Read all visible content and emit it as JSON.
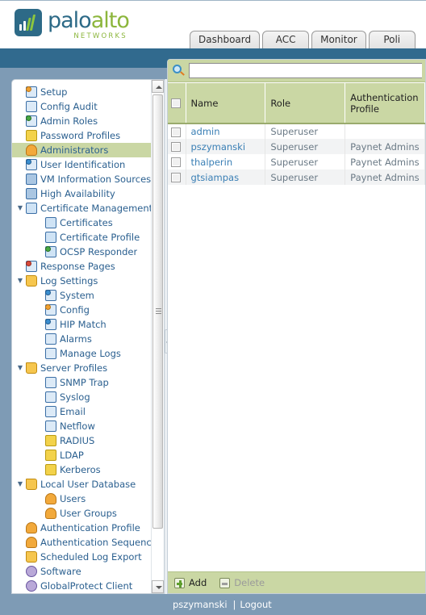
{
  "brand": {
    "name_part1": "palo",
    "name_part2": "alto",
    "tagline": "NETWORKS",
    "logo_icon": "paloalto-bars-logo"
  },
  "tabs": [
    {
      "label": "Dashboard"
    },
    {
      "label": "ACC"
    },
    {
      "label": "Monitor"
    },
    {
      "label": "Poli"
    }
  ],
  "sidebar": {
    "items": [
      {
        "label": "Setup",
        "level": 1,
        "twisty": "",
        "icon": "setup-icon",
        "selected": false
      },
      {
        "label": "Config Audit",
        "level": 1,
        "twisty": "",
        "icon": "config-audit-icon",
        "selected": false
      },
      {
        "label": "Admin Roles",
        "level": 1,
        "twisty": "",
        "icon": "admin-roles-icon",
        "selected": false
      },
      {
        "label": "Password Profiles",
        "level": 1,
        "twisty": "",
        "icon": "password-profiles-icon",
        "selected": false
      },
      {
        "label": "Administrators",
        "level": 1,
        "twisty": "",
        "icon": "administrators-icon",
        "selected": true
      },
      {
        "label": "User Identification",
        "level": 1,
        "twisty": "",
        "icon": "user-identification-icon",
        "selected": false
      },
      {
        "label": "VM Information Sources",
        "level": 1,
        "twisty": "",
        "icon": "vm-information-sources-icon",
        "selected": false
      },
      {
        "label": "High Availability",
        "level": 1,
        "twisty": "",
        "icon": "high-availability-icon",
        "selected": false
      },
      {
        "label": "Certificate Management",
        "level": 1,
        "twisty": "▼",
        "icon": "certificate-management-icon",
        "selected": false
      },
      {
        "label": "Certificates",
        "level": 2,
        "twisty": "",
        "icon": "certificates-icon",
        "selected": false
      },
      {
        "label": "Certificate Profile",
        "level": 2,
        "twisty": "",
        "icon": "certificate-profile-icon",
        "selected": false
      },
      {
        "label": "OCSP Responder",
        "level": 2,
        "twisty": "",
        "icon": "ocsp-responder-icon",
        "selected": false
      },
      {
        "label": "Response Pages",
        "level": 1,
        "twisty": "",
        "icon": "response-pages-icon",
        "selected": false
      },
      {
        "label": "Log Settings",
        "level": 1,
        "twisty": "▼",
        "icon": "log-settings-icon",
        "selected": false
      },
      {
        "label": "System",
        "level": 2,
        "twisty": "",
        "icon": "system-icon",
        "selected": false
      },
      {
        "label": "Config",
        "level": 2,
        "twisty": "",
        "icon": "config-icon",
        "selected": false
      },
      {
        "label": "HIP Match",
        "level": 2,
        "twisty": "",
        "icon": "hip-match-icon",
        "selected": false
      },
      {
        "label": "Alarms",
        "level": 2,
        "twisty": "",
        "icon": "alarms-icon",
        "selected": false
      },
      {
        "label": "Manage Logs",
        "level": 2,
        "twisty": "",
        "icon": "manage-logs-icon",
        "selected": false
      },
      {
        "label": "Server Profiles",
        "level": 1,
        "twisty": "▼",
        "icon": "server-profiles-icon",
        "selected": false
      },
      {
        "label": "SNMP Trap",
        "level": 2,
        "twisty": "",
        "icon": "snmp-trap-icon",
        "selected": false
      },
      {
        "label": "Syslog",
        "level": 2,
        "twisty": "",
        "icon": "syslog-icon",
        "selected": false
      },
      {
        "label": "Email",
        "level": 2,
        "twisty": "",
        "icon": "email-icon",
        "selected": false
      },
      {
        "label": "Netflow",
        "level": 2,
        "twisty": "",
        "icon": "netflow-icon",
        "selected": false
      },
      {
        "label": "RADIUS",
        "level": 2,
        "twisty": "",
        "icon": "radius-icon",
        "selected": false
      },
      {
        "label": "LDAP",
        "level": 2,
        "twisty": "",
        "icon": "ldap-icon",
        "selected": false
      },
      {
        "label": "Kerberos",
        "level": 2,
        "twisty": "",
        "icon": "kerberos-icon",
        "selected": false
      },
      {
        "label": "Local User Database",
        "level": 1,
        "twisty": "▼",
        "icon": "local-user-database-icon",
        "selected": false
      },
      {
        "label": "Users",
        "level": 2,
        "twisty": "",
        "icon": "users-icon",
        "selected": false
      },
      {
        "label": "User Groups",
        "level": 2,
        "twisty": "",
        "icon": "user-groups-icon",
        "selected": false
      },
      {
        "label": "Authentication Profile",
        "level": 1,
        "twisty": "",
        "icon": "authentication-profile-icon",
        "selected": false
      },
      {
        "label": "Authentication Sequence",
        "level": 1,
        "twisty": "",
        "icon": "authentication-sequence-icon",
        "selected": false
      },
      {
        "label": "Scheduled Log Export",
        "level": 1,
        "twisty": "",
        "icon": "scheduled-log-export-icon",
        "selected": false
      },
      {
        "label": "Software",
        "level": 1,
        "twisty": "",
        "icon": "software-icon",
        "selected": false
      },
      {
        "label": "GlobalProtect Client",
        "level": 1,
        "twisty": "",
        "icon": "globalprotect-client-icon",
        "selected": false
      }
    ]
  },
  "search": {
    "value": "",
    "placeholder": "",
    "icon": "search-icon"
  },
  "table": {
    "columns": [
      "Name",
      "Role",
      "Authentication Profile"
    ],
    "rows": [
      {
        "name": "admin",
        "role": "Superuser",
        "auth_profile": ""
      },
      {
        "name": "pszymanski",
        "role": "Superuser",
        "auth_profile": "Paynet Admins"
      },
      {
        "name": "thalperin",
        "role": "Superuser",
        "auth_profile": "Paynet Admins"
      },
      {
        "name": "gtsiampas",
        "role": "Superuser",
        "auth_profile": "Paynet Admins"
      }
    ]
  },
  "actions": {
    "add_label": "Add",
    "delete_label": "Delete"
  },
  "statusbar": {
    "user": "pszymanski",
    "separator": "|",
    "logout_label": "Logout"
  },
  "colors": {
    "header_teal": "#316a8e",
    "page_blue": "#7e9bb5",
    "accent_green": "#cad7a4",
    "link_blue": "#3a7fb5",
    "brand_blue": "#2d6a87",
    "brand_green": "#8cb63c"
  }
}
